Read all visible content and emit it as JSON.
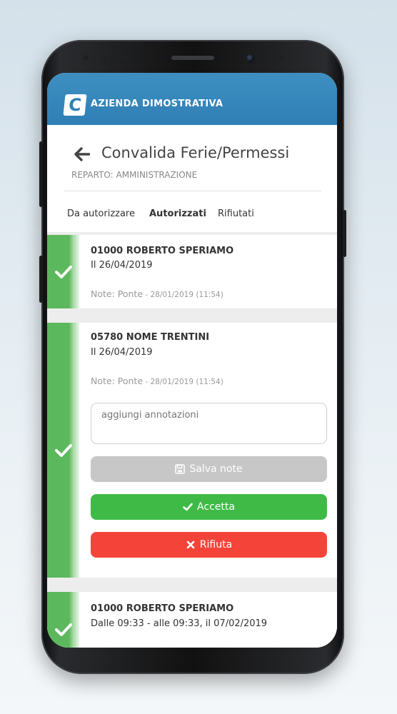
{
  "app": {
    "logo_letter": "C",
    "company_name": "AZIENDA DIMOSTRATIVA",
    "brand_color": "#2f7fb5"
  },
  "header": {
    "title": "Convalida Ferie/Permessi",
    "department": "REPARTO: AMMINISTRAZIONE",
    "back_icon": "arrow-left-icon"
  },
  "tabs": [
    {
      "label": "Da autorizzare",
      "active": false
    },
    {
      "label": "Autorizzati",
      "active": true
    },
    {
      "label": "Rifiutati",
      "active": false
    }
  ],
  "requests": [
    {
      "name": "01000 ROBERTO SPERIAMO",
      "when": "Il 26/04/2019",
      "note_label": "Note: Ponte",
      "note_meta": " - 28/01/2019 (11:54)",
      "status_icon": "check-icon"
    },
    {
      "name": "05780 NOME TRENTINI",
      "when": "Il 26/04/2019",
      "note_label": "Note: Ponte",
      "note_meta": " - 28/01/2019 (11:54)",
      "status_icon": "check-icon",
      "annotation_placeholder": "aggiungi annotazioni",
      "save_label": "Salva note",
      "accept_label": "Accetta",
      "reject_label": "Rifiuta"
    },
    {
      "name": "01000 ROBERTO SPERIAMO",
      "when": "Dalle 09:33 - alle 09:33, il 07/02/2019",
      "status_icon": "check-icon"
    }
  ],
  "colors": {
    "approved_stripe": "#5cb85c",
    "accept": "#3fba47",
    "reject": "#f4443a",
    "save_disabled": "#c7c7c7"
  }
}
